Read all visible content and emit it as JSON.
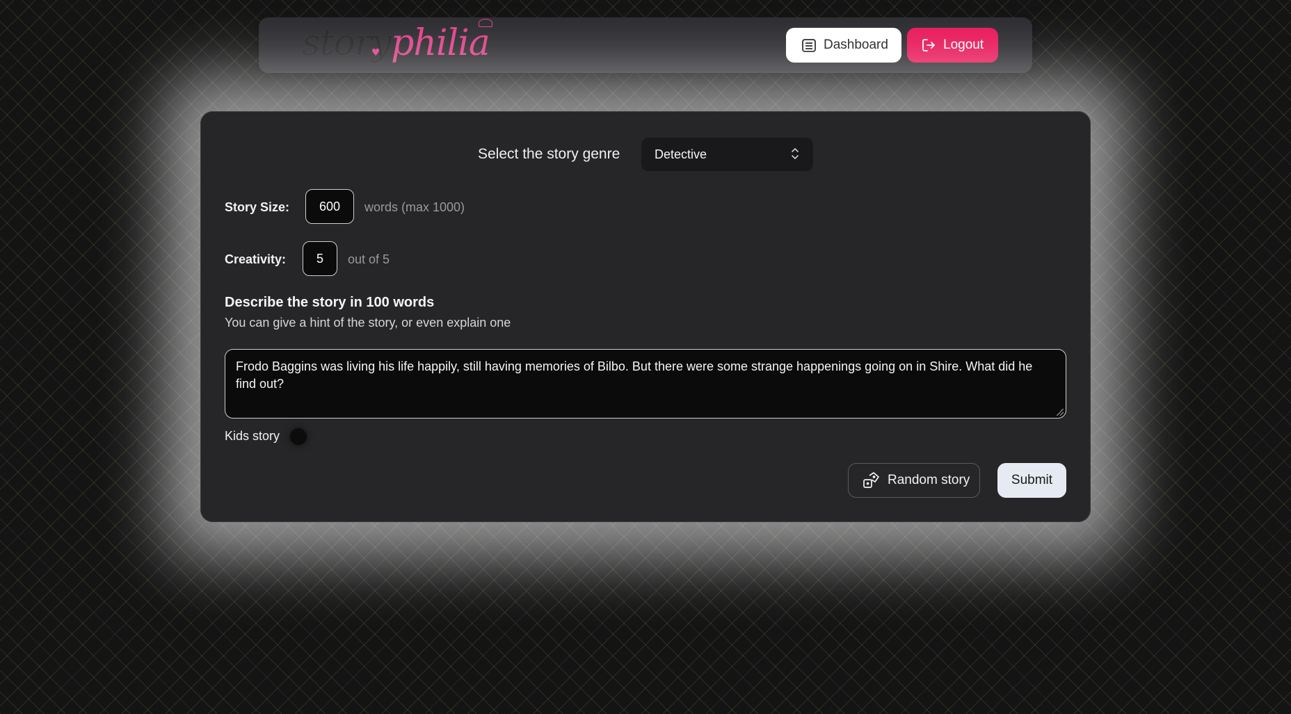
{
  "header": {
    "logo_part1": "story",
    "logo_part2": "philia",
    "dashboard_label": "Dashboard",
    "logout_label": "Logout"
  },
  "form": {
    "genre_label": "Select the story genre",
    "genre_value": "Detective",
    "size_label": "Story Size:",
    "size_value": "600",
    "size_hint": "words (max 1000)",
    "creativity_label": "Creativity:",
    "creativity_value": "5",
    "creativity_hint": "out of 5",
    "description_title": "Describe the story in 100 words",
    "description_subtitle": "You can give a hint of the story, or even explain one",
    "description_value": "Frodo Baggins was living his life happily, still having memories of Bilbo. But there were some strange happenings going on in Shire. What did he find out?",
    "kids_label": "Kids story",
    "kids_enabled": false,
    "random_label": "Random story",
    "submit_label": "Submit"
  },
  "icons": {
    "dashboard": "dashboard-icon",
    "logout": "logout-icon",
    "random": "dice-icon",
    "select": "chevron-up-down-icon"
  },
  "colors": {
    "brand": "#e0418a",
    "logout": "#e8185a",
    "card": "#262629",
    "submit": "#e6eaf2"
  }
}
